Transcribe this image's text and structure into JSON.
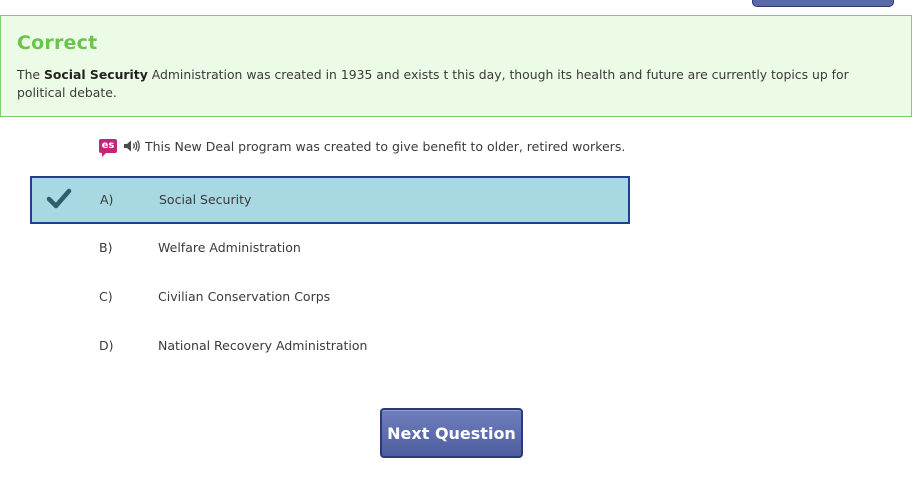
{
  "feedback": {
    "title": "Correct",
    "text_before": "The ",
    "text_bold": "Social Security",
    "text_after": " Administration was created in 1935 and exists t this day, though its health and future are currently topics up for political debate.",
    "color": "#6bc44f"
  },
  "question": {
    "badge": "es",
    "icons": [
      "translate-es-icon",
      "speaker-icon"
    ],
    "text": "This New Deal program was created to give benefit to older, retired workers."
  },
  "options": [
    {
      "letter": "A)",
      "text": "Social Security",
      "selected": true
    },
    {
      "letter": "B)",
      "text": "Welfare Administration",
      "selected": false
    },
    {
      "letter": "C)",
      "text": "Civilian Conservation Corps",
      "selected": false
    },
    {
      "letter": "D)",
      "text": "National Recovery Administration",
      "selected": false
    }
  ],
  "next_button": {
    "label": "Next Question"
  },
  "colors": {
    "selected_bg": "#a8d8e2",
    "selected_border": "#233e8b",
    "button": "#5a6aa8",
    "feedback_bg": "#ecfbe6"
  }
}
